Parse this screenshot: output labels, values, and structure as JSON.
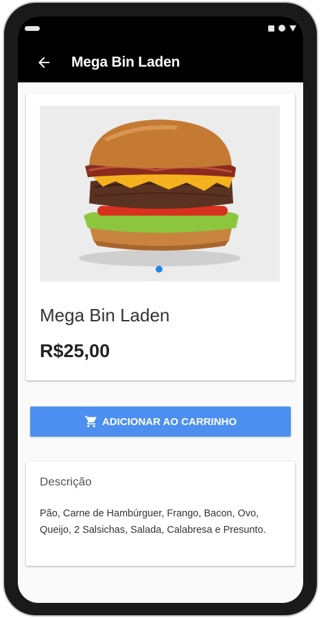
{
  "appbar": {
    "title": "Mega Bin Laden"
  },
  "product": {
    "image_icon": "burger-photo",
    "name": "Mega Bin Laden",
    "price": "R$25,00",
    "pager": {
      "count": 1,
      "active": 0
    }
  },
  "actions": {
    "add_to_cart_label": "ADICIONAR AO CARRINHO",
    "cart_icon": "shopping-cart-icon"
  },
  "description": {
    "title": "Descrição",
    "text": "Pão, Carne de Hambúrguer, Frango, Bacon, Ovo, Queijo, 2 Salsichas, Salada, Calabresa e Presunto."
  },
  "colors": {
    "appbar": "#000000",
    "button": "#4d8ff0",
    "pager_active": "#1e88e5"
  }
}
